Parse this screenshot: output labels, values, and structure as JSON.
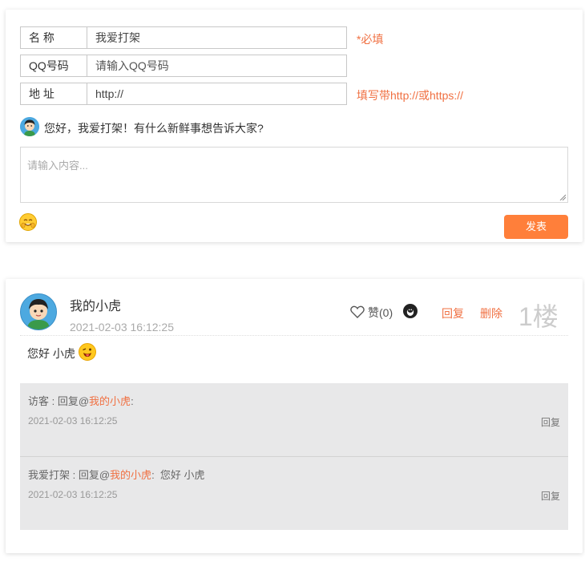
{
  "form": {
    "name_label": "名 称",
    "name_value": "我爱打架",
    "name_hint": "*必填",
    "qq_label": "QQ号码",
    "qq_placeholder": "请输入QQ号码",
    "url_label": "地 址",
    "url_value": "http://",
    "url_hint": "填写带http://或https://",
    "greeting": "您好，我爱打架！有什么新鲜事想告诉大家?",
    "content_placeholder": "请输入内容...",
    "submit_label": "发表"
  },
  "comment": {
    "author": "我的小虎",
    "time": "2021-02-03 16:12:25",
    "like_label": "赞(0)",
    "reply_label": "回复",
    "delete_label": "删除",
    "floor": "1楼",
    "body": "您好 小虎",
    "replies": [
      {
        "prefix": "访客 : 回复@",
        "target": "我的小虎",
        "suffix": ":",
        "time": "2021-02-03 16:12:25",
        "reply_label": "回复"
      },
      {
        "prefix": "我爱打架 : 回复@",
        "target": "我的小虎",
        "suffix": ":  您好 小虎",
        "time": "2021-02-03 16:12:25",
        "reply_label": "回复"
      }
    ]
  },
  "colors": {
    "accent": "#f07042",
    "button": "#ff7f3a",
    "reply_bg": "#e8e8e9"
  }
}
